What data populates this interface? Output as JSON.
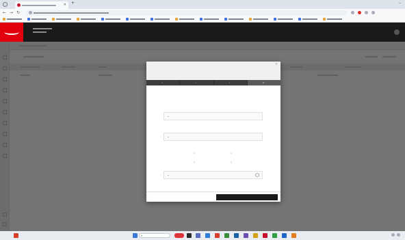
{
  "browser": {
    "tab_title": "",
    "url": "",
    "bookmarks": [
      "",
      "",
      "",
      "",
      "",
      "",
      "",
      "",
      "",
      "",
      "",
      "",
      "",
      ""
    ]
  },
  "app": {
    "header_title": "",
    "header_subtitle": "",
    "subbar_text": ""
  },
  "modal": {
    "title": "",
    "subtitle": "",
    "steps": [
      {
        "label": ""
      },
      {
        "label": ""
      },
      {
        "label": ""
      },
      {
        "label": ""
      }
    ],
    "fields": [
      {
        "label": "",
        "value": ""
      },
      {
        "label": "",
        "value": ""
      }
    ],
    "sections": [
      {
        "title": ""
      },
      {
        "title": ""
      },
      {
        "title": ""
      }
    ],
    "details": {
      "label_a": "",
      "value_a_label": "",
      "value_a": "",
      "label_b": "",
      "label_c": "",
      "opt1": "",
      "opt2": "",
      "opt3": "",
      "opt4": "",
      "footer_label": "",
      "footer_value": ""
    },
    "back_label": "",
    "next_label": ""
  },
  "taskbar": {
    "search_placeholder": "",
    "time": "",
    "date": ""
  },
  "colors": {
    "brand_red": "#e2000f",
    "header_dark": "#1a1a1a",
    "overlay": "#747474",
    "step_active": "#5a5a5a"
  }
}
